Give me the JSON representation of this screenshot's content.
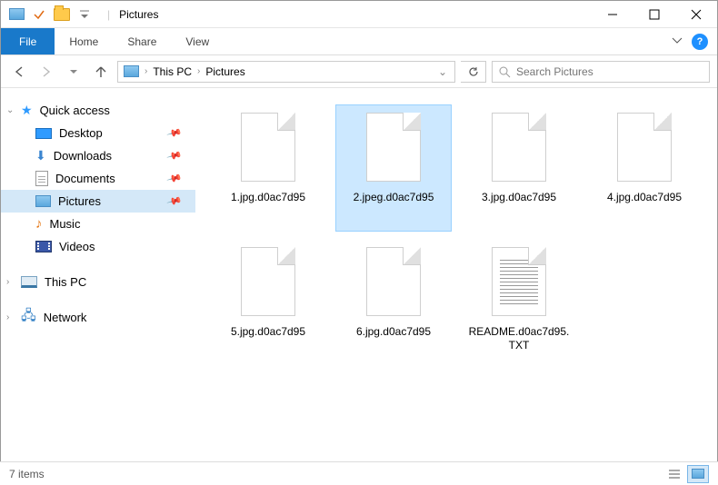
{
  "window": {
    "title": "Pictures"
  },
  "ribbon": {
    "file": "File",
    "tabs": [
      "Home",
      "Share",
      "View"
    ]
  },
  "breadcrumb": {
    "segments": [
      "This PC",
      "Pictures"
    ]
  },
  "search": {
    "placeholder": "Search Pictures"
  },
  "sidebar": {
    "quick_access": "Quick access",
    "pinned": [
      {
        "label": "Desktop",
        "icon": "desktop"
      },
      {
        "label": "Downloads",
        "icon": "downloads"
      },
      {
        "label": "Documents",
        "icon": "document"
      },
      {
        "label": "Pictures",
        "icon": "pictures",
        "selected": true
      },
      {
        "label": "Music",
        "icon": "music"
      },
      {
        "label": "Videos",
        "icon": "videos"
      }
    ],
    "this_pc": "This PC",
    "network": "Network"
  },
  "files": [
    {
      "label": "1.jpg.d0ac7d95",
      "type": "generic",
      "selected": false
    },
    {
      "label": "2.jpeg.d0ac7d95",
      "type": "generic",
      "selected": true
    },
    {
      "label": "3.jpg.d0ac7d95",
      "type": "generic",
      "selected": false
    },
    {
      "label": "4.jpg.d0ac7d95",
      "type": "generic",
      "selected": false
    },
    {
      "label": "5.jpg.d0ac7d95",
      "type": "generic",
      "selected": false
    },
    {
      "label": "6.jpg.d0ac7d95",
      "type": "generic",
      "selected": false
    },
    {
      "label": "README.d0ac7d95.TXT",
      "type": "text",
      "selected": false
    }
  ],
  "status": {
    "text": "7 items"
  }
}
